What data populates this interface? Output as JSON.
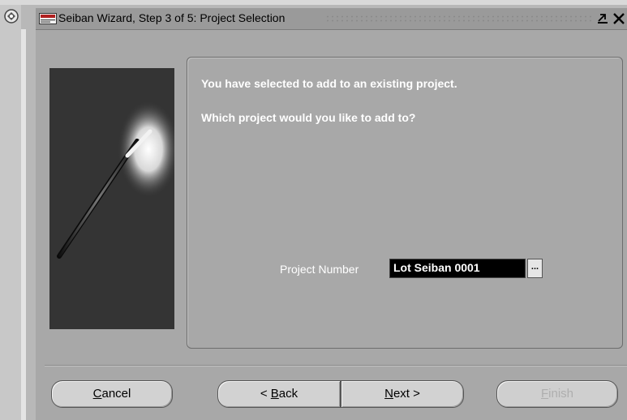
{
  "window": {
    "title": "Seiban Wizard, Step 3 of 5: Project Selection"
  },
  "prompts": {
    "line1": "You have selected to add to an existing project.",
    "line2": "Which project would you like to add to?"
  },
  "project": {
    "label": "Project Number",
    "value": "Lot Seiban 0001",
    "lov_label": "..."
  },
  "buttons": {
    "cancel": {
      "mnemonic": "C",
      "rest": "ancel"
    },
    "back": {
      "prefix": "< ",
      "mnemonic": "B",
      "rest": "ack"
    },
    "next": {
      "mnemonic": "N",
      "rest": "ext >"
    },
    "finish": {
      "mnemonic": "F",
      "rest": "inish",
      "enabled": false
    }
  },
  "colors": {
    "dialog_background": "#a8a8a8",
    "title_bar": "#9a9a9a",
    "image_panel": "#343434",
    "prompt_text": "#ffffff",
    "selected_field": "#000000"
  },
  "icons": {
    "app": "oracle-forms-icon",
    "title": "oracle-applications-icon",
    "wizard": "magic-wand-icon",
    "minimize": "minimize-icon",
    "close": "close-icon",
    "lov": "ellipsis-icon"
  }
}
